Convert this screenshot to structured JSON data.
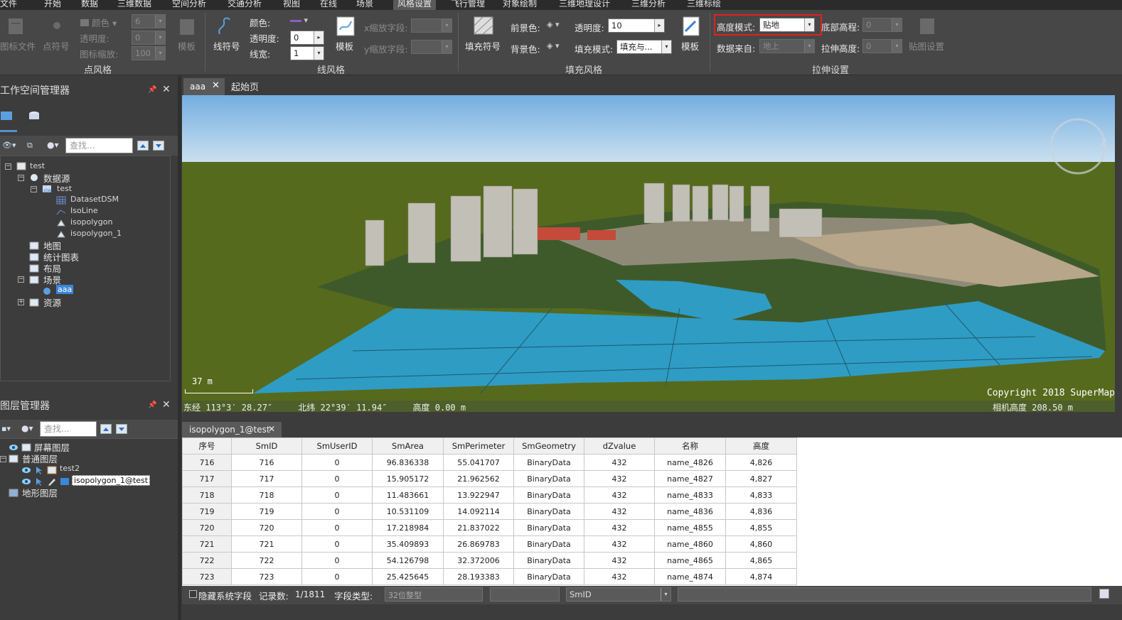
{
  "menu": [
    "文件",
    "开始",
    "数据",
    "三维数据",
    "空间分析",
    "交通分析",
    "视图",
    "在线",
    "场景",
    "风格设置",
    "飞行管理",
    "对象绘制",
    "三维地理设计",
    "三维分析",
    "三维标绘"
  ],
  "menu_active": "风格设置",
  "ribbon": {
    "point_group": {
      "name": "点风格",
      "icon_file": "图标文件",
      "point_symbol": "点符号",
      "color_label": "颜色",
      "color_value": "6",
      "opacity_label": "透明度:",
      "opacity_value": "0",
      "scale_label": "图标缩放:",
      "scale_value": "100",
      "template": "模板"
    },
    "line_group": {
      "name": "线风格",
      "line_symbol": "线符号",
      "color_label": "颜色:",
      "opacity_label": "透明度:",
      "opacity_value": "0",
      "width_label": "线宽:",
      "width_value": "1",
      "template": "模板",
      "x_scale_label": "x缩放字段:",
      "y_scale_label": "y缩放字段:"
    },
    "fill_group": {
      "name": "填充风格",
      "fill_symbol": "填充符号",
      "fg_label": "前景色:",
      "bg_label": "背景色:",
      "opacity_label": "透明度:",
      "opacity_value": "10",
      "fill_mode_label": "填充模式:",
      "fill_mode_value": "填充与...",
      "template": "模板"
    },
    "extrude_group": {
      "name": "拉伸设置",
      "height_mode_label": "高度模式:",
      "height_mode_value": "贴地",
      "base_height_label": "底部高程:",
      "base_height_value": "0",
      "data_source_label": "数据来自:",
      "data_source_value": "地上",
      "extrude_height_label": "拉伸高度:",
      "extrude_height_value": "0",
      "texture_settings": "贴图设置"
    },
    "highlight_color": "#e02020"
  },
  "workspace": {
    "title": "工作空间管理器",
    "search_placeholder": "查找...",
    "tree": {
      "root": "test",
      "datasource": "数据源",
      "ds_test": "test",
      "ds_items": [
        "DatasetDSM",
        "IsoLine",
        "isopolygon",
        "isopolygon_1"
      ],
      "map": "地图",
      "chart": "统计图表",
      "layout": "布局",
      "scene": "场景",
      "scene_item": "aaa",
      "resource": "资源"
    }
  },
  "layers": {
    "title": "图层管理器",
    "search_placeholder": "查找...",
    "screen_layer": "屏幕图层",
    "normal_layer": "普通图层",
    "layer_items": [
      "test2",
      "isopolygon_1@test"
    ],
    "terrain_layer": "地形图层"
  },
  "tabs": [
    "aaa",
    "起始页"
  ],
  "scene": {
    "scale_text": "37 m",
    "copyright": "Copyright 2018 SuperMap",
    "coords": "东经 113°3′ 28.27″     北纬 22°39′ 11.94″     高度 0.00 m",
    "camera_height": "相机高度 208.50 m"
  },
  "attr_tab": "isopolygon_1@test",
  "table": {
    "headers": [
      "序号",
      "SmID",
      "SmUserID",
      "SmArea",
      "SmPerimeter",
      "SmGeometry",
      "dZvalue",
      "名称",
      "高度"
    ],
    "rows": [
      [
        "716",
        "716",
        "0",
        "96.836338",
        "55.041707",
        "BinaryData",
        "432",
        "name_4826",
        "4,826"
      ],
      [
        "717",
        "717",
        "0",
        "15.905172",
        "21.962562",
        "BinaryData",
        "432",
        "name_4827",
        "4,827"
      ],
      [
        "718",
        "718",
        "0",
        "11.483661",
        "13.922947",
        "BinaryData",
        "432",
        "name_4833",
        "4,833"
      ],
      [
        "719",
        "719",
        "0",
        "10.531109",
        "14.092114",
        "BinaryData",
        "432",
        "name_4836",
        "4,836"
      ],
      [
        "720",
        "720",
        "0",
        "17.218984",
        "21.837022",
        "BinaryData",
        "432",
        "name_4855",
        "4,855"
      ],
      [
        "721",
        "721",
        "0",
        "35.409893",
        "26.869783",
        "BinaryData",
        "432",
        "name_4860",
        "4,860"
      ],
      [
        "722",
        "722",
        "0",
        "54.126798",
        "32.372006",
        "BinaryData",
        "432",
        "name_4865",
        "4,865"
      ],
      [
        "723",
        "723",
        "0",
        "25.425645",
        "28.193383",
        "BinaryData",
        "432",
        "name_4874",
        "4,874"
      ]
    ]
  },
  "statusbar": {
    "hide_sys_fields": "隐藏系统字段",
    "record_label": "记录数:",
    "record_value": "1/1811",
    "field_type_label": "字段类型:",
    "field_type_value": "32位整型",
    "field_value": "SmID"
  }
}
